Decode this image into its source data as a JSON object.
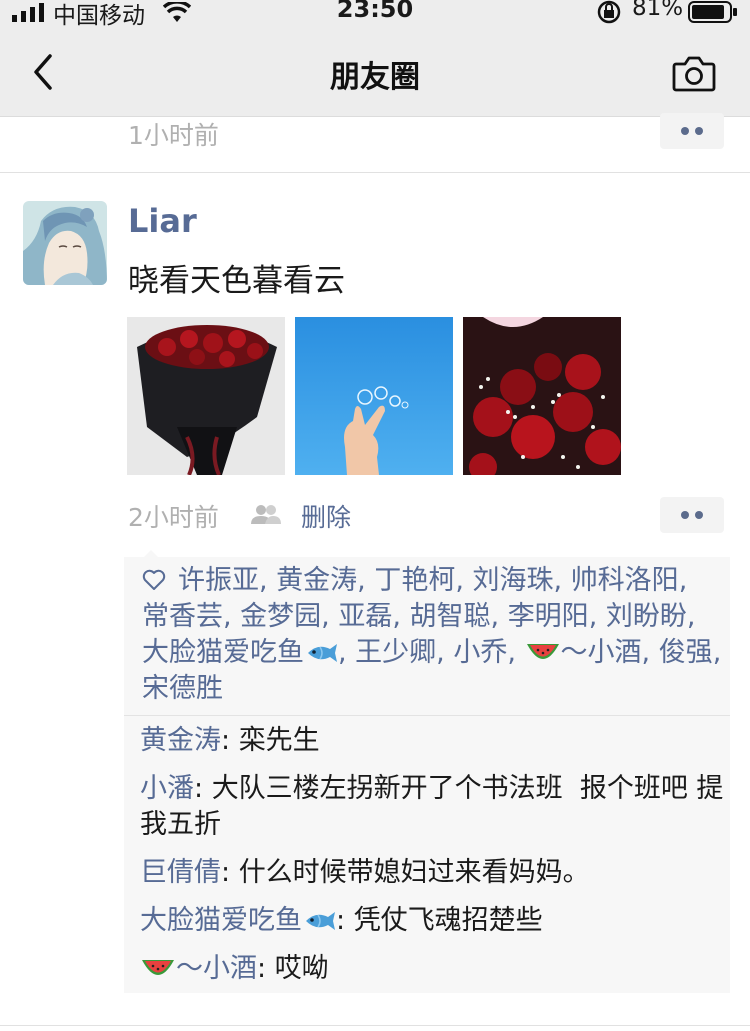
{
  "status_bar": {
    "carrier": "中国移动",
    "time": "23:50",
    "battery": "81%"
  },
  "nav": {
    "title": "朋友圈",
    "back_icon": "chevron-left-icon",
    "camera_icon": "camera-icon"
  },
  "previous_post": {
    "time": "1小时前"
  },
  "post": {
    "username": "Liar",
    "text": "晓看天色暮看云",
    "photos": [
      "roses-bouquet-photo",
      "blue-sky-hand-photo",
      "red-roses-photo"
    ],
    "time": "2小时前",
    "delete_label": "删除"
  },
  "likes": {
    "names": [
      "许振亚",
      "黄金涛",
      "丁艳柯",
      "刘海珠",
      "帅科洛阳",
      "常香芸",
      "金梦园",
      "亚磊",
      "胡智聪",
      "李明阳",
      "刘盼盼",
      "大脸猫爱吃鱼",
      "王少卿",
      "小乔",
      "～小酒",
      "俊强",
      "宋德胜"
    ]
  },
  "comments": [
    {
      "author": "黄金涛",
      "text": "栾先生"
    },
    {
      "author": "小潘",
      "text": "大队三楼左拐新开了个书法班  报个班吧 提我五折"
    },
    {
      "author": "巨倩倩",
      "text": "什么时候带媳妇过来看妈妈。"
    },
    {
      "author": "大脸猫爱吃鱼",
      "text": "凭仗飞魂招楚些"
    },
    {
      "author": "～小酒",
      "text": "哎呦"
    }
  ],
  "colors": {
    "link": "#576b95",
    "nav_background": "#ededed",
    "panel_background": "#f7f7f7"
  }
}
